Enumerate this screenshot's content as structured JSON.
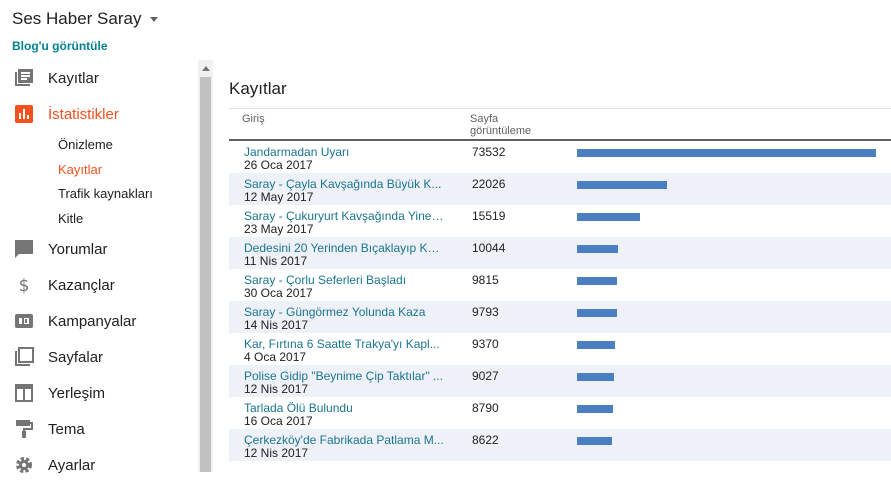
{
  "header": {
    "blog_title": "Ses Haber Saray",
    "view_blog": "Blog'u görüntüle"
  },
  "sidebar": {
    "items": [
      {
        "label": "Kayıtlar",
        "icon": "posts-icon",
        "active": false
      },
      {
        "label": "İstatistikler",
        "icon": "stats-icon",
        "active": true
      },
      {
        "label": "Yorumlar",
        "icon": "comments-icon",
        "active": false
      },
      {
        "label": "Kazançlar",
        "icon": "dollar-icon",
        "active": false
      },
      {
        "label": "Kampanyalar",
        "icon": "ad-icon",
        "active": false
      },
      {
        "label": "Sayfalar",
        "icon": "pages-icon",
        "active": false
      },
      {
        "label": "Yerleşim",
        "icon": "layout-icon",
        "active": false
      },
      {
        "label": "Tema",
        "icon": "paint-roller-icon",
        "active": false
      },
      {
        "label": "Ayarlar",
        "icon": "gear-icon",
        "active": false
      }
    ],
    "subitems": [
      {
        "label": "Önizleme",
        "active": false
      },
      {
        "label": "Kayıtlar",
        "active": true
      },
      {
        "label": "Trafik kaynakları",
        "active": false
      },
      {
        "label": "Kitle",
        "active": false
      }
    ]
  },
  "main": {
    "title": "Kayıtlar",
    "columns": {
      "entry": "Giriş",
      "views": "Sayfa görüntüleme"
    },
    "rows": [
      {
        "title": "Jandarmadan Uyarı",
        "date": "26 Oca 2017",
        "views": "73532",
        "value": 73532
      },
      {
        "title": "Saray - Çayla Kavşağında Büyük K...",
        "date": "12 May 2017",
        "views": "22026",
        "value": 22026
      },
      {
        "title": "Saray - Çukuryurt Kavşağında Yine ...",
        "date": "23 May 2017",
        "views": "15519",
        "value": 15519
      },
      {
        "title": "Dedesini 20 Yerinden Bıçaklayıp Ku...",
        "date": "11 Nis 2017",
        "views": "10044",
        "value": 10044
      },
      {
        "title": "Saray - Çorlu Seferleri Başladı",
        "date": "30 Oca 2017",
        "views": "9815",
        "value": 9815
      },
      {
        "title": "Saray - Güngörmez Yolunda Kaza",
        "date": "14 Nis 2017",
        "views": "9793",
        "value": 9793
      },
      {
        "title": "Kar, Fırtına 6 Saatte Trakya'yı Kapl...",
        "date": "4 Oca 2017",
        "views": "9370",
        "value": 9370
      },
      {
        "title": "Polise Gidip \"Beynime Çip Taktılar\" ...",
        "date": "12 Nis 2017",
        "views": "9027",
        "value": 9027
      },
      {
        "title": "Tarlada Ölü Bulundu",
        "date": "16 Oca 2017",
        "views": "8790",
        "value": 8790
      },
      {
        "title": "Çerkezköy'de Fabrikada Patlama M...",
        "date": "12 Nis 2017",
        "views": "8622",
        "value": 8622
      }
    ]
  },
  "colors": {
    "accent": "#f4511e",
    "link": "#1a7590",
    "bar": "#4a7fc1",
    "row_alt": "#eef1f8"
  }
}
